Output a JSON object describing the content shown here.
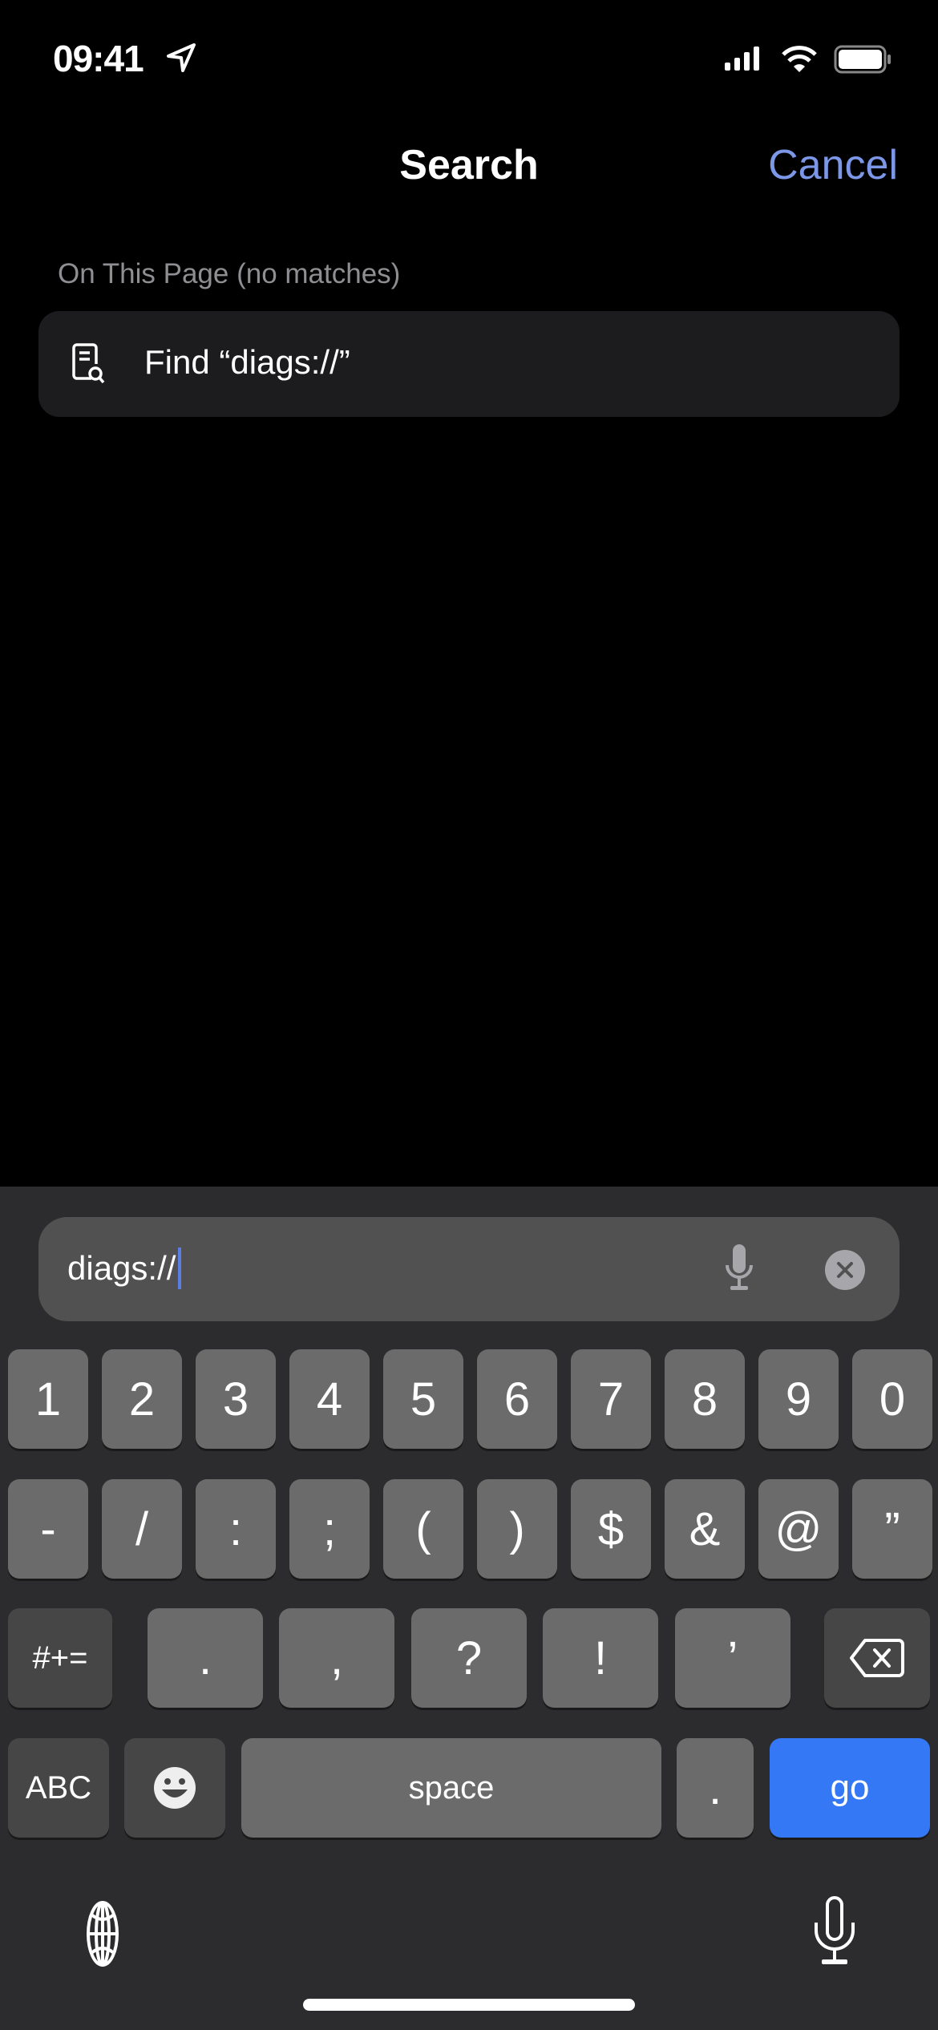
{
  "status_bar": {
    "time": "09:41",
    "icons": [
      "location-arrow-icon",
      "cellular-signal-icon",
      "wifi-icon",
      "battery-icon"
    ]
  },
  "nav": {
    "title": "Search",
    "cancel_label": "Cancel",
    "accent": "#7d97e8"
  },
  "section_header": "On This Page (no matches)",
  "find_row": {
    "label": "Find “diags://”",
    "icon": "find-in-page-icon"
  },
  "search_field": {
    "value": "diags://",
    "icons": [
      "microphone-icon",
      "clear-icon"
    ]
  },
  "keyboard": {
    "row1": [
      "1",
      "2",
      "3",
      "4",
      "5",
      "6",
      "7",
      "8",
      "9",
      "0"
    ],
    "row2": [
      "-",
      "/",
      ":",
      ";",
      "(",
      ")",
      "$",
      "&",
      "@",
      "”"
    ],
    "row3": {
      "shift_label": "#+=",
      "keys": [
        ".",
        ",",
        "?",
        "!",
        "’"
      ],
      "delete_icon": "delete-backspace-icon"
    },
    "row4": {
      "abc_label": "ABC",
      "emoji_icon": "emoji-icon",
      "space_label": "space",
      "dot_label": ".",
      "go_label": "go",
      "go_color": "#3478f6"
    },
    "bottom": {
      "globe_icon": "globe-icon",
      "dictation_icon": "microphone-icon"
    }
  }
}
